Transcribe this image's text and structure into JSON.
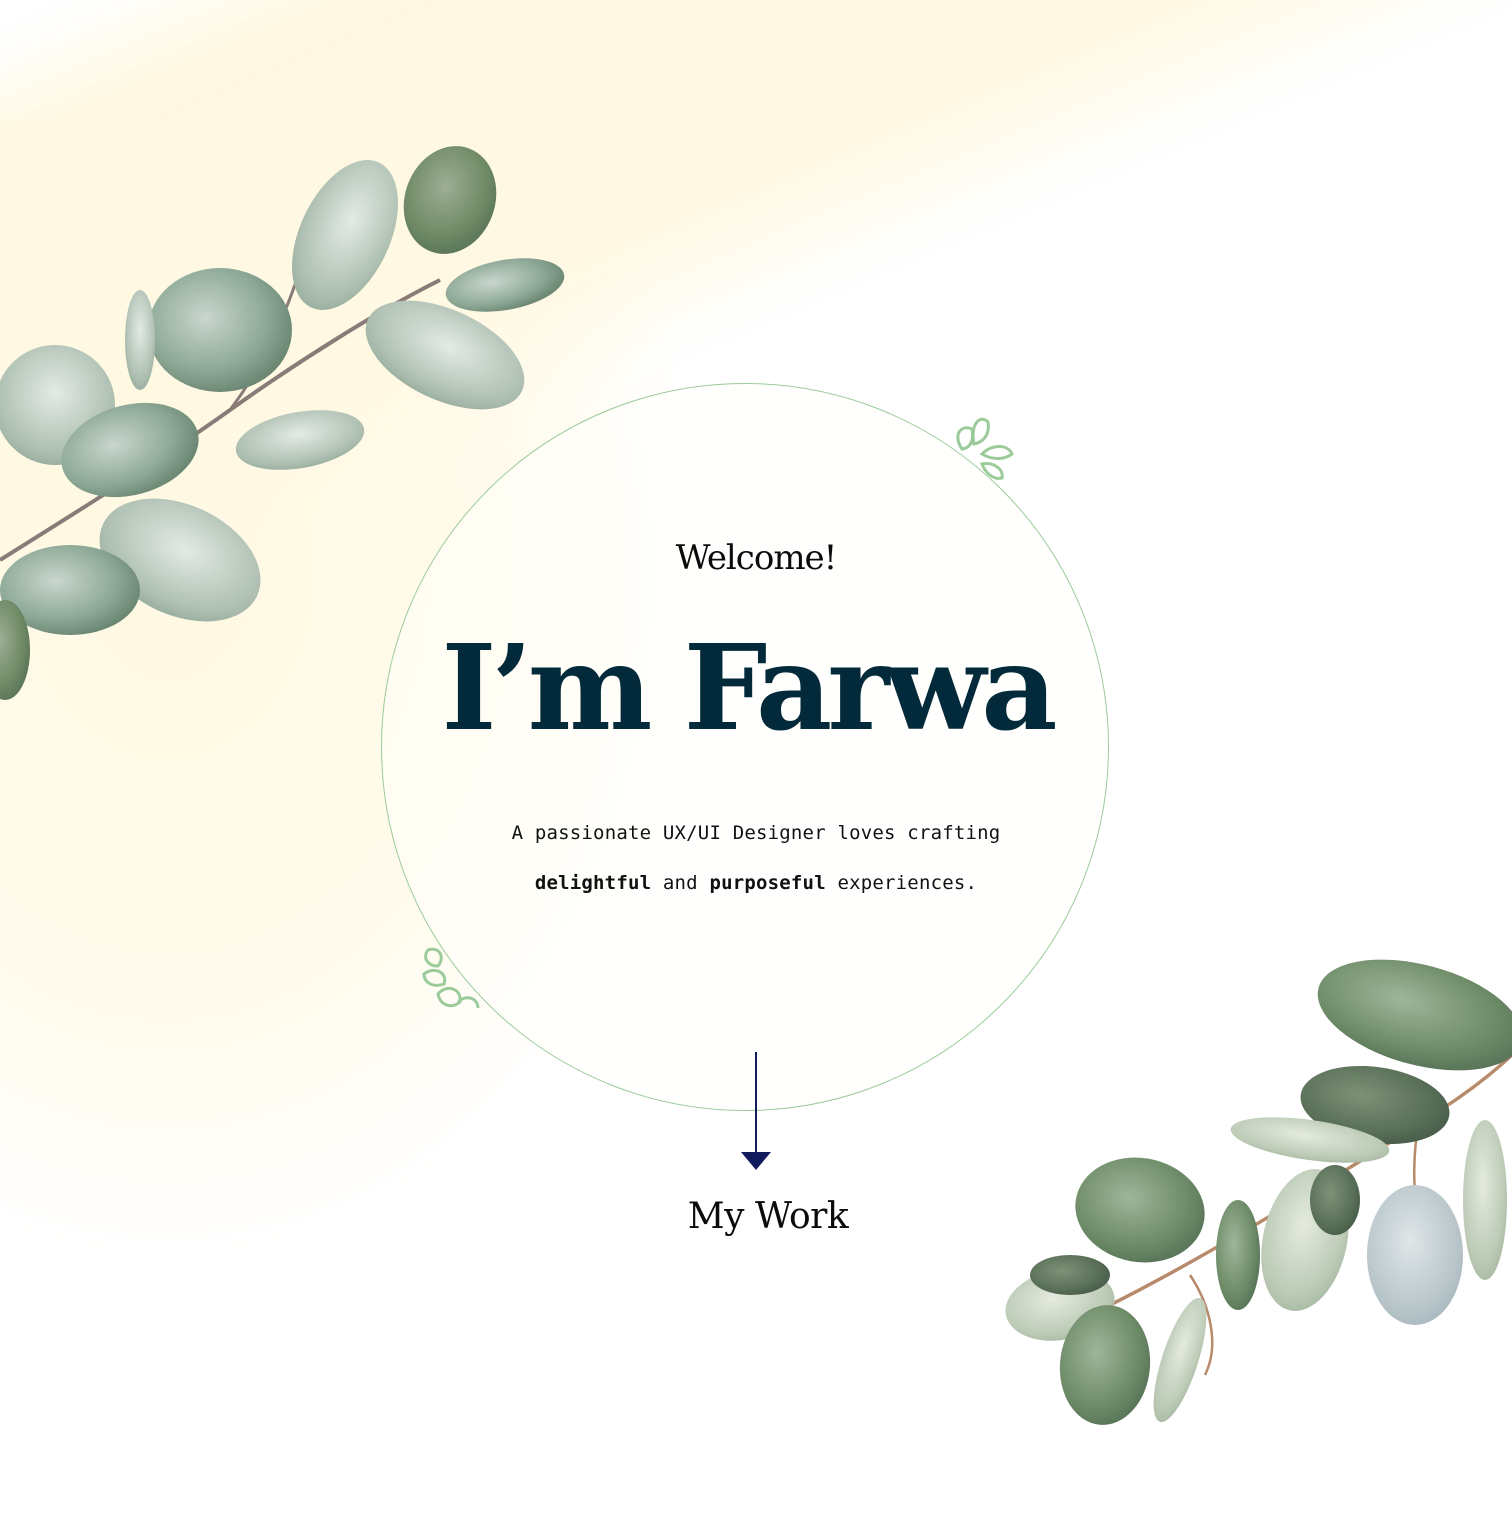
{
  "hero": {
    "welcome": "Welcome!",
    "name": "I’m Farwa",
    "tagline_line1": "A passionate UX/UI Designer loves crafting",
    "tagline_bold1": "delightful",
    "tagline_and": "and",
    "tagline_bold2": "purposeful",
    "tagline_end": "experiences."
  },
  "nav": {
    "my_work": "My Work"
  },
  "colors": {
    "name_color": "#032a3a",
    "arrow_color": "#101a5c",
    "circle_border": "#9ccb9a",
    "glow": "#fff8e1",
    "leaf_dark": "#5c7a66",
    "leaf_light": "#b9c9bd"
  },
  "icons": {
    "top_branch": "eucalyptus-branch-icon",
    "bottom_branch": "eucalyptus-branch-icon",
    "sprig": "leaf-sprig-outline-icon",
    "scroll": "arrow-down-icon"
  }
}
